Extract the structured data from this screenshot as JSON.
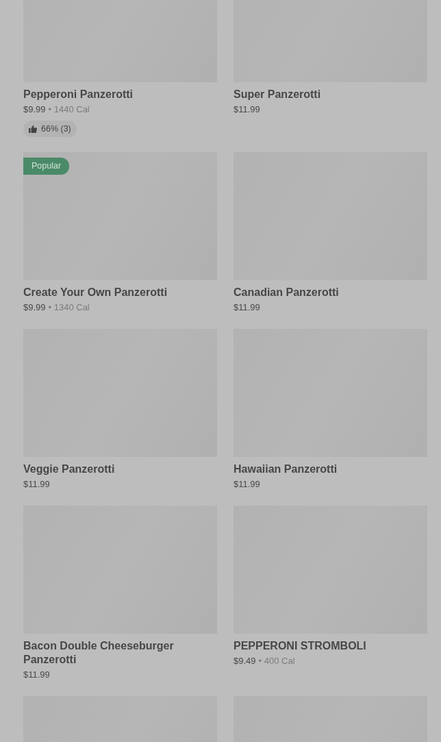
{
  "menu_items": [
    {
      "kind": "card",
      "name": "Pepperoni Panzerotti",
      "price": "$9.99",
      "calories": "• 1440 Cal",
      "rating": "66% (3)"
    },
    {
      "kind": "card",
      "name": "Super Panzerotti",
      "price": "$11.99"
    },
    {
      "kind": "card",
      "badge": "Popular",
      "name": "Create Your Own Panzerotti",
      "price": "$9.99",
      "calories": "• 1340 Cal"
    },
    {
      "kind": "card",
      "name": "Canadian Panzerotti",
      "price": "$11.99"
    },
    {
      "kind": "card",
      "name": "Veggie Panzerotti",
      "price": "$11.99"
    },
    {
      "kind": "card",
      "name": "Hawaiian Panzerotti",
      "price": "$11.99"
    },
    {
      "kind": "card",
      "name": "Bacon Double Cheeseburger Panzerotti",
      "price": "$11.99"
    },
    {
      "kind": "card",
      "name": "PEPPERONI STROMBOLI",
      "price": "$9.49",
      "calories": "• 400 Cal"
    },
    {
      "kind": "image-only"
    },
    {
      "kind": "image-only"
    }
  ]
}
